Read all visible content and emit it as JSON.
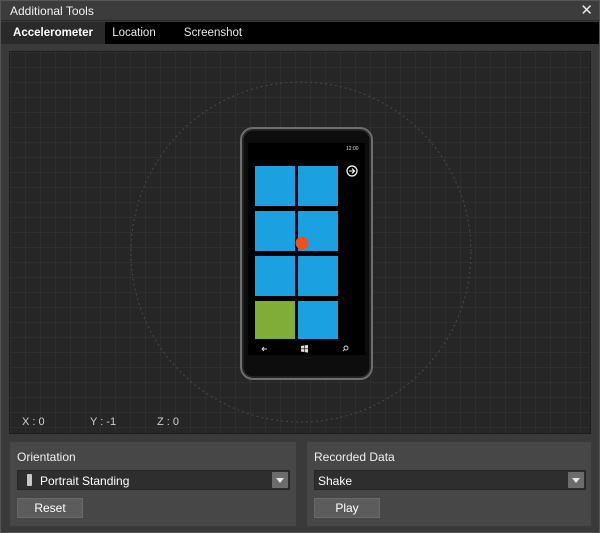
{
  "window": {
    "title": "Additional Tools"
  },
  "tabs": [
    {
      "label": "Accelerometer",
      "active": true
    },
    {
      "label": "Location",
      "active": false
    },
    {
      "label": "Screenshot",
      "active": false
    }
  ],
  "readout": {
    "x": "X : 0",
    "y": "Y : -1",
    "z": "Z : 0"
  },
  "phone": {
    "clock": "12:00",
    "tile_color": "#1ba1e2",
    "accent_tile_color": "#7fad38",
    "dot_color": "#f0501e"
  },
  "orientation": {
    "heading": "Orientation",
    "selected": "Portrait Standing",
    "reset_label": "Reset"
  },
  "recorded": {
    "heading": "Recorded Data",
    "selected": "Shake",
    "play_label": "Play"
  }
}
